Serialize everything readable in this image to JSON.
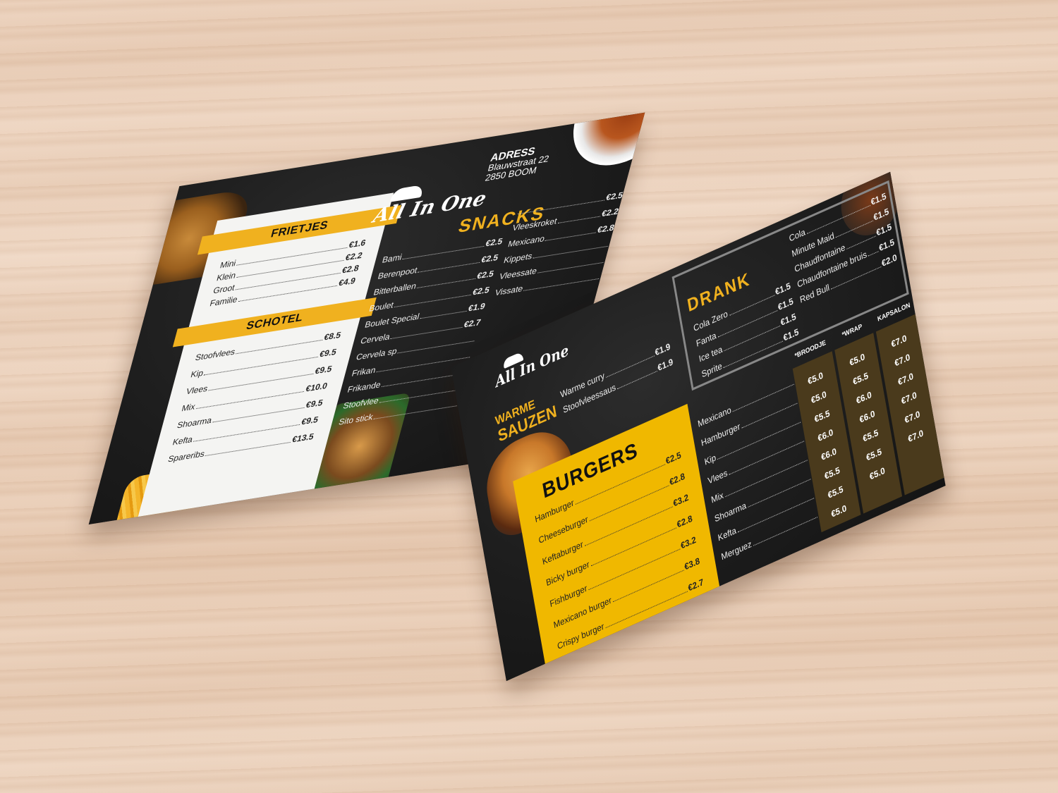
{
  "brand": {
    "name": "All In One"
  },
  "address": {
    "title": "ADRESS",
    "line1": "Blauwstraat 22",
    "line2": "2850 BOOM"
  },
  "frietjes": {
    "title": "FRIETJES",
    "items": [
      {
        "name": "Mini",
        "price": "€1.6"
      },
      {
        "name": "Klein",
        "price": "€2.2"
      },
      {
        "name": "Groot",
        "price": "€2.8"
      },
      {
        "name": "Familie",
        "price": "€4.9"
      }
    ]
  },
  "schotel": {
    "title": "SCHOTEL",
    "items": [
      {
        "name": "Stoofvlees",
        "price": "€8.5"
      },
      {
        "name": "Kip",
        "price": "€9.5"
      },
      {
        "name": "Vlees",
        "price": "€9.5"
      },
      {
        "name": "Mix",
        "price": "€10.0"
      },
      {
        "name": "Shoarma",
        "price": "€9.5"
      },
      {
        "name": "Kefta",
        "price": "€9.5"
      },
      {
        "name": "Spareribs",
        "price": "€13.5"
      }
    ]
  },
  "snacks": {
    "title": "SNACKS",
    "left": [
      {
        "name": "Bami",
        "price": "€2.5"
      },
      {
        "name": "Berenpoot",
        "price": "€2.5"
      },
      {
        "name": "Bitterballen",
        "price": "€2.5"
      },
      {
        "name": "Boulet",
        "price": "€2.5"
      },
      {
        "name": "Boulet Special",
        "price": "€1.9"
      },
      {
        "name": "Cervela",
        "price": "€2.7"
      },
      {
        "name": "Cervela sp",
        "price": ""
      },
      {
        "name": "Frikan",
        "price": ""
      },
      {
        "name": "Frikande",
        "price": ""
      },
      {
        "name": "Stoofvlee",
        "price": ""
      },
      {
        "name": "Sito stick",
        "price": ""
      }
    ],
    "right": [
      {
        "name": "",
        "price": "€2.5"
      },
      {
        "name": "Vleeskroket",
        "price": "€2.2"
      },
      {
        "name": "Mexicano",
        "price": "€2.8"
      },
      {
        "name": "Kippets",
        "price": ""
      },
      {
        "name": "Vleessate",
        "price": ""
      },
      {
        "name": "Vissate",
        "price": ""
      }
    ]
  },
  "sauzen": {
    "title1": "WARME",
    "title2": "SAUZEN",
    "items": [
      {
        "name": "Warme curry",
        "price": "€1.9"
      },
      {
        "name": "Stoofvleessaus",
        "price": "€1.9"
      }
    ]
  },
  "burgers": {
    "title": "BURGERS",
    "items": [
      {
        "name": "Hamburger",
        "price": "€2.5"
      },
      {
        "name": "Cheeseburger",
        "price": "€2.8"
      },
      {
        "name": "Keftaburger",
        "price": "€3.2"
      },
      {
        "name": "Bicky burger",
        "price": "€2.8"
      },
      {
        "name": "Fishburger",
        "price": "€3.2"
      },
      {
        "name": "Mexicano burger",
        "price": "€3.8"
      },
      {
        "name": "Crispy burger",
        "price": "€2.7"
      }
    ]
  },
  "drank": {
    "title": "DRANK",
    "left": [
      {
        "name": "Cola Zero",
        "price": "€1.5"
      },
      {
        "name": "Fanta",
        "price": "€1.5"
      },
      {
        "name": "Ice tea",
        "price": "€1.5"
      },
      {
        "name": "Sprite",
        "price": "€1.5"
      }
    ],
    "right": [
      {
        "name": "Cola",
        "price": "€1.5"
      },
      {
        "name": "Minute Maid",
        "price": "€1.5"
      },
      {
        "name": "Chaudfontaine",
        "price": "€1.5"
      },
      {
        "name": "Chaudfontaine bruis",
        "price": "€1.5"
      },
      {
        "name": "Red Bull",
        "price": "€2.0"
      }
    ]
  },
  "broodje": {
    "headers": [
      "*BROODJE",
      "*WRAP",
      "KAPSALON"
    ],
    "rows": [
      {
        "name": "Mexicano",
        "prices": [
          "€5.0",
          "€5.0",
          "€7.0"
        ]
      },
      {
        "name": "Hamburger",
        "prices": [
          "€5.0",
          "€5.5",
          "€7.0"
        ]
      },
      {
        "name": "Kip",
        "prices": [
          "€5.5",
          "€6.0",
          "€7.0"
        ]
      },
      {
        "name": "Vlees",
        "prices": [
          "€6.0",
          "€6.0",
          "€7.0"
        ]
      },
      {
        "name": "Mix",
        "prices": [
          "€6.0",
          "€5.5",
          "€7.0"
        ]
      },
      {
        "name": "Shoarma",
        "prices": [
          "€5.5",
          "€5.5",
          "€7.0"
        ]
      },
      {
        "name": "Kefta",
        "prices": [
          "€5.5",
          "€5.0",
          ""
        ]
      },
      {
        "name": "Merguez",
        "prices": [
          "€5.0",
          "",
          ""
        ]
      }
    ]
  },
  "colors": {
    "accent": "#f0b11f",
    "board": "#1c1c1c",
    "paper": "#f4f4f2",
    "wood": "#ecd2bd"
  }
}
